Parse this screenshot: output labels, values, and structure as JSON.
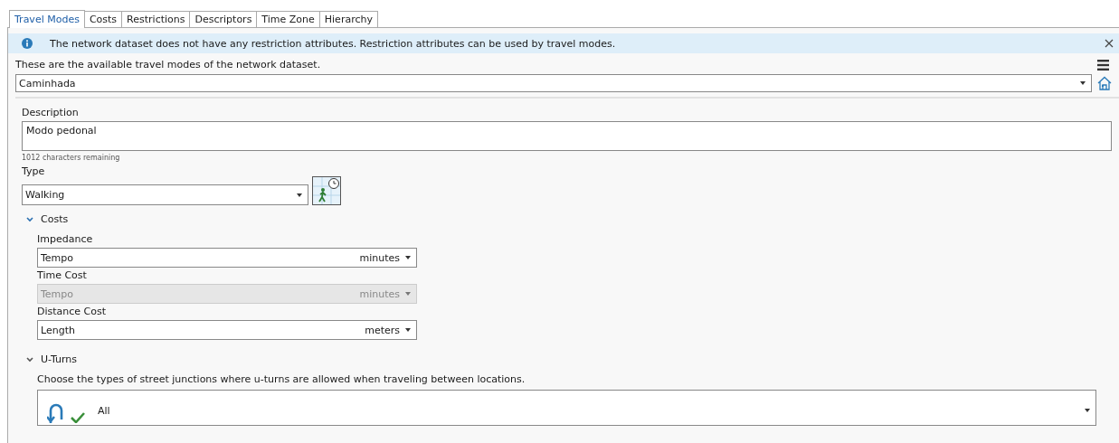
{
  "tabs": [
    {
      "label": "Travel Modes",
      "selected": true
    },
    {
      "label": "Costs",
      "selected": false
    },
    {
      "label": "Restrictions",
      "selected": false
    },
    {
      "label": "Descriptors",
      "selected": false
    },
    {
      "label": "Time Zone",
      "selected": false
    },
    {
      "label": "Hierarchy",
      "selected": false
    }
  ],
  "info_bar": {
    "message": "The network dataset does not have any restriction attributes. Restriction attributes can be used by travel modes."
  },
  "intro": "These are the available travel modes of the network dataset.",
  "travel_mode": {
    "value": "Caminhada"
  },
  "description": {
    "label": "Description",
    "value": "Modo pedonal",
    "remaining": "1012 characters remaining"
  },
  "type": {
    "label": "Type",
    "value": "Walking"
  },
  "costs": {
    "title": "Costs",
    "expanded": true,
    "fields": [
      {
        "label": "Impedance",
        "value": "Tempo",
        "unit": "minutes",
        "disabled": false
      },
      {
        "label": "Time Cost",
        "value": "Tempo",
        "unit": "minutes",
        "disabled": true
      },
      {
        "label": "Distance Cost",
        "value": "Length",
        "unit": "meters",
        "disabled": false
      }
    ]
  },
  "u_turns": {
    "title": "U-Turns",
    "expanded": true,
    "hint": "Choose the types of street junctions where u-turns are allowed when traveling between locations.",
    "value": "All"
  }
}
